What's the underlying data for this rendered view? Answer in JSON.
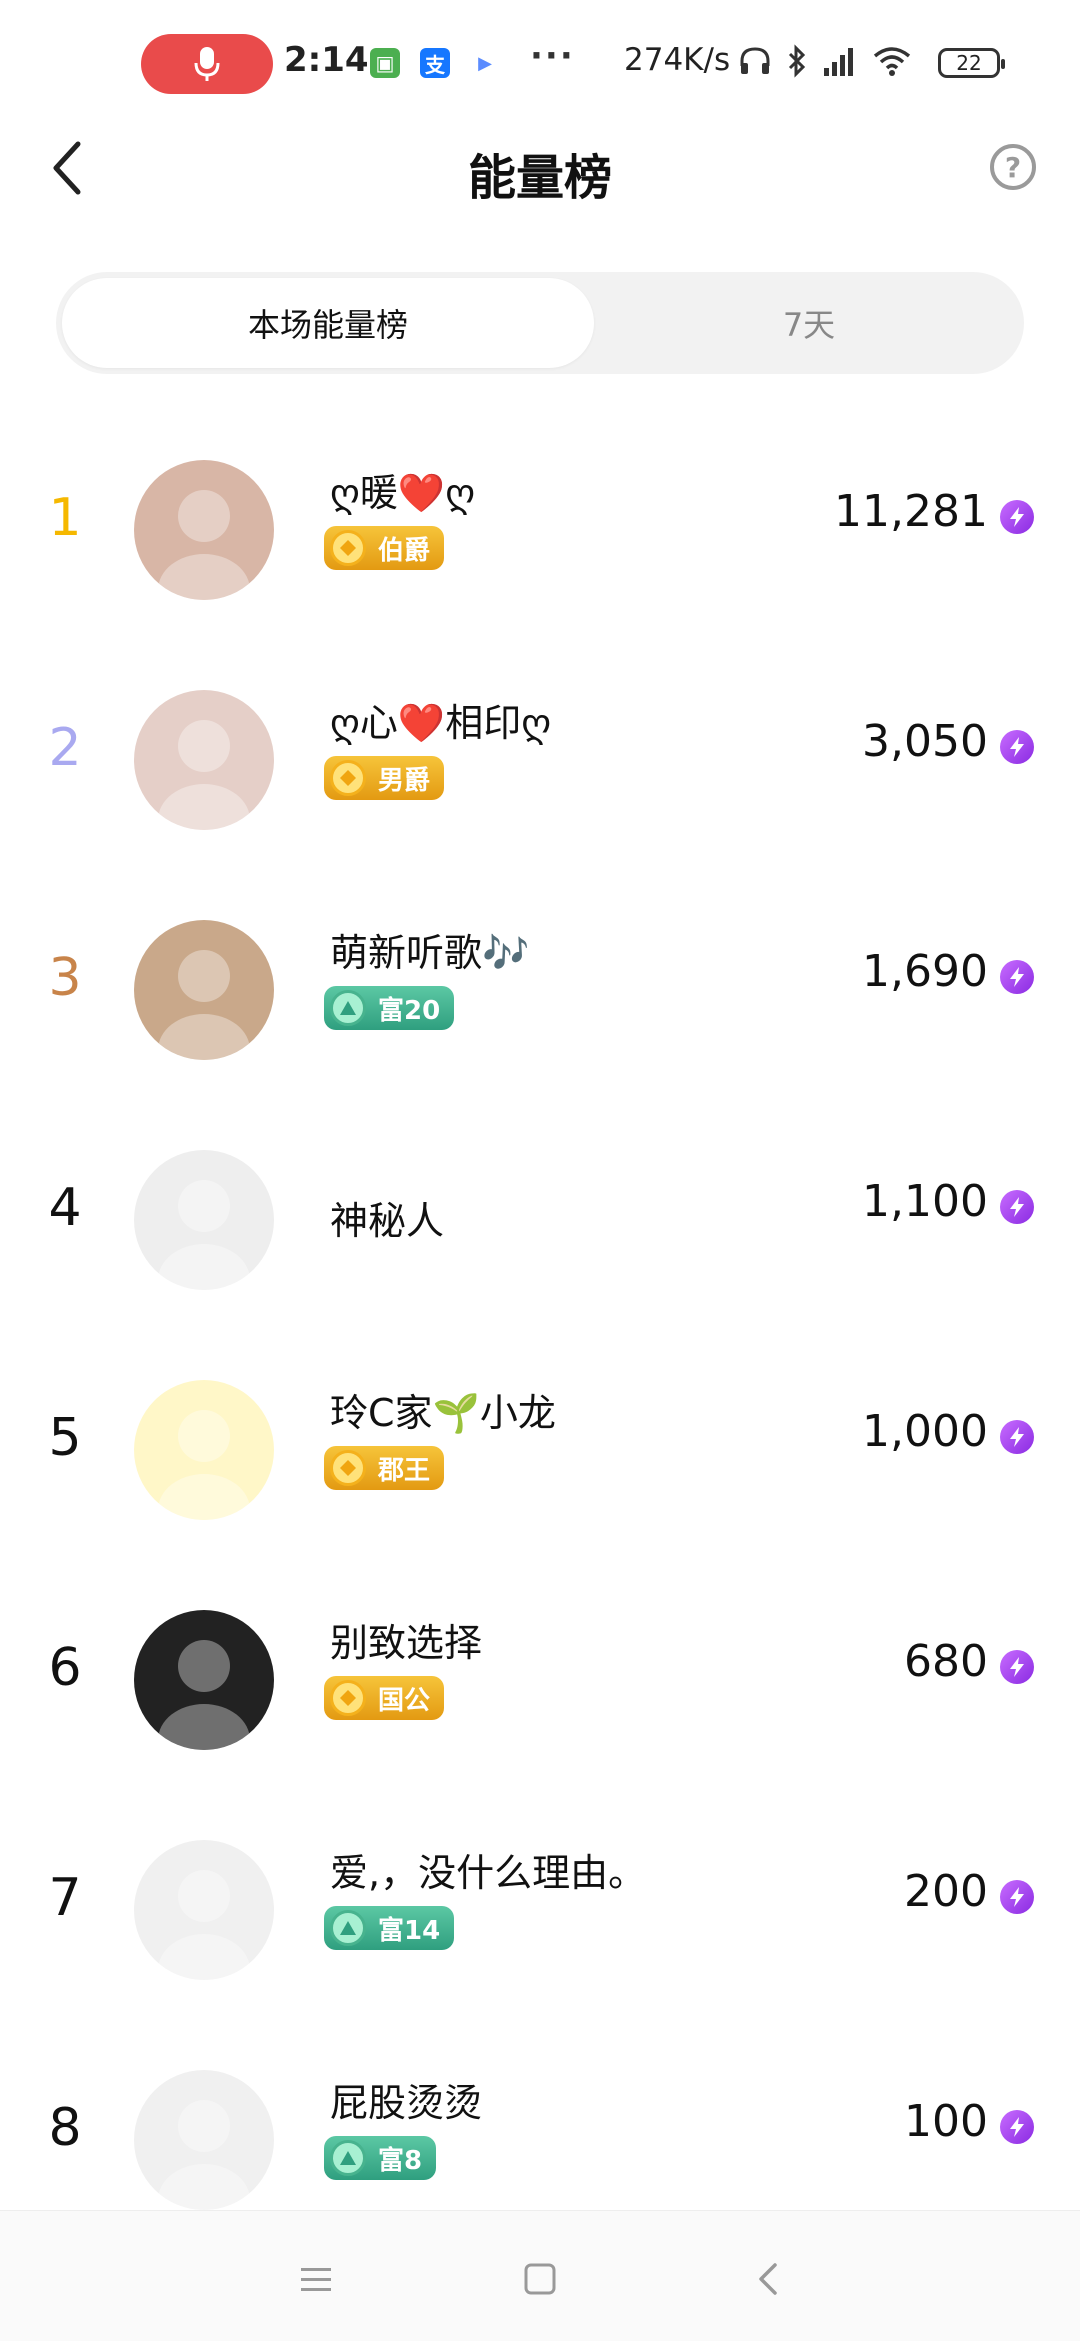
{
  "status_bar": {
    "time": "2:14",
    "network_speed": "274K/s",
    "battery": "22",
    "more": "···",
    "app_icons": [
      {
        "name": "android-app-icon",
        "color": "#4caf50",
        "glyph": "▣"
      },
      {
        "name": "alipay-icon",
        "color": "#1677ff",
        "glyph": "支"
      },
      {
        "name": "play-store-icon",
        "color": "#ffffff",
        "glyph": "▶"
      }
    ]
  },
  "header": {
    "title": "能量榜",
    "help_glyph": "?"
  },
  "tabs": [
    {
      "label": "本场能量榜",
      "active": true
    },
    {
      "label": "7天",
      "active": false
    }
  ],
  "rank_colors": {
    "1": "#f5b800",
    "2": "#a9a9f0",
    "3": "#c8844a",
    "default": "#111111"
  },
  "ranking": [
    {
      "rank": "1",
      "name": "ღ暖❤️ღ",
      "badge": "伯爵",
      "badge_type": "gold",
      "score": "11,281",
      "avatar_bg": "#d8b6a6"
    },
    {
      "rank": "2",
      "name": "ღ心❤️相印ღ",
      "badge": "男爵",
      "badge_type": "gold",
      "score": "3,050",
      "avatar_bg": "#e5cfc8"
    },
    {
      "rank": "3",
      "name": "萌新听歌🎶",
      "badge": "富20",
      "badge_type": "green",
      "score": "1,690",
      "avatar_bg": "#c9a88a"
    },
    {
      "rank": "4",
      "name": "神秘人",
      "badge": "",
      "badge_type": "",
      "score": "1,100",
      "avatar_bg": "#eeeeee"
    },
    {
      "rank": "5",
      "name": "玲C家🌱小龙",
      "badge": "郡王",
      "badge_type": "gold",
      "score": "1,000",
      "avatar_bg": "#fff7c8"
    },
    {
      "rank": "6",
      "name": "别致选择",
      "badge": "国公",
      "badge_type": "gold",
      "score": "680",
      "avatar_bg": "#222222"
    },
    {
      "rank": "7",
      "name": "爱,，没什么理由。",
      "badge": "富14",
      "badge_type": "green",
      "score": "200",
      "avatar_bg": "#f0f0f0"
    },
    {
      "rank": "8",
      "name": "屁股烫烫",
      "badge": "富8",
      "badge_type": "green",
      "score": "100",
      "avatar_bg": "#f0f0f0"
    }
  ]
}
